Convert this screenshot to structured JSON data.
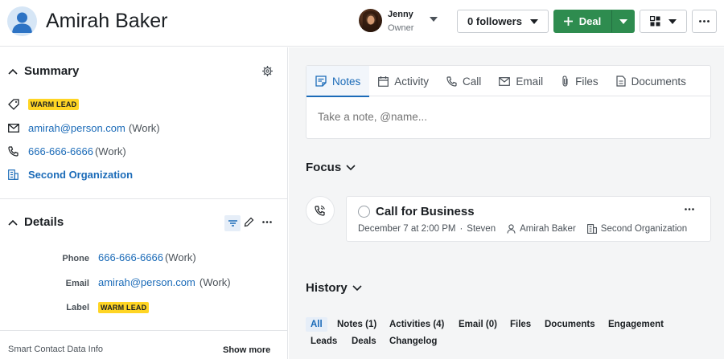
{
  "header": {
    "person_name": "Amirah Baker",
    "owner_name": "Jenny",
    "owner_role": "Owner",
    "followers_label": "0 followers",
    "deal_label": "Deal"
  },
  "summary": {
    "title": "Summary",
    "label_badge": "WARM LEAD",
    "email": "amirah@person.com",
    "email_type": "(Work)",
    "phone": "666-666-6666",
    "phone_type": "(Work)",
    "organization": "Second Organization"
  },
  "details": {
    "title": "Details",
    "phone_label": "Phone",
    "phone": "666-666-6666",
    "phone_type": "(Work)",
    "email_label": "Email",
    "email": "amirah@person.com",
    "email_type": "(Work)",
    "label_label": "Label",
    "label_badge": "WARM LEAD"
  },
  "footer": {
    "smart_data": "Smart Contact Data Info",
    "show_more": "Show more"
  },
  "composer": {
    "tabs": [
      "Notes",
      "Activity",
      "Call",
      "Email",
      "Files",
      "Documents"
    ],
    "placeholder": "Take a note, @name..."
  },
  "focus": {
    "title": "Focus",
    "activity_title": "Call for Business",
    "activity_datetime": "December 7 at 2:00 PM",
    "activity_owner": "Steven",
    "activity_person": "Amirah Baker",
    "activity_org": "Second Organization"
  },
  "history": {
    "title": "History",
    "filters": [
      "All",
      "Notes (1)",
      "Activities (4)",
      "Email (0)",
      "Files",
      "Documents",
      "Engagement",
      "Leads",
      "Deals",
      "Changelog"
    ]
  },
  "colors": {
    "accent": "#1b6bb8",
    "deal_green": "#2e8c4f",
    "badge_yellow": "#ffd524"
  },
  "icons": [
    "person-avatar-icon",
    "chevron-down-icon",
    "plus-icon",
    "grid-view-icon",
    "more-dots-icon",
    "gear-icon",
    "tag-icon",
    "envelope-icon",
    "phone-icon",
    "building-icon",
    "filter-icon",
    "pencil-icon",
    "note-icon",
    "calendar-icon",
    "paperclip-icon",
    "document-icon",
    "phone-call-icon",
    "person-icon"
  ]
}
